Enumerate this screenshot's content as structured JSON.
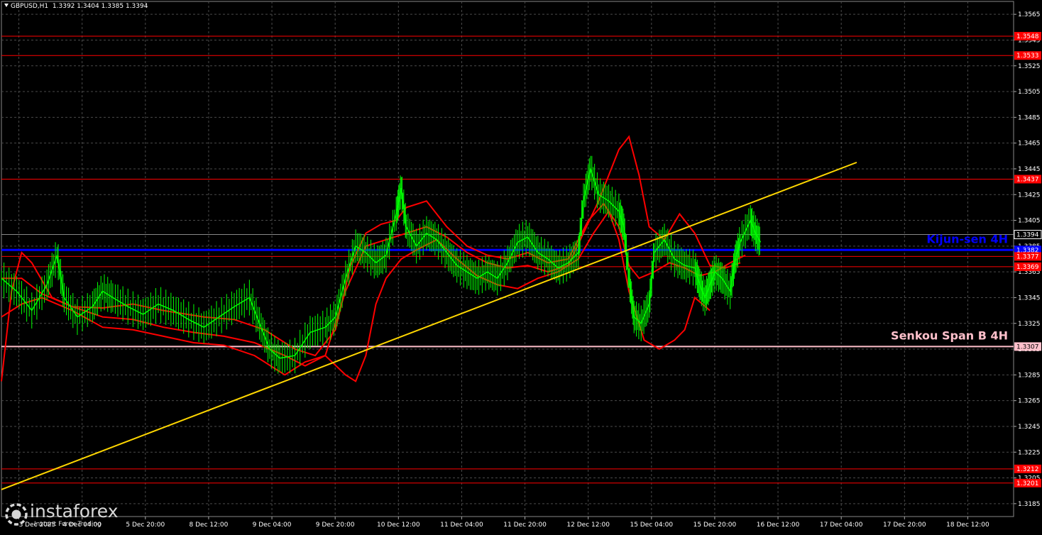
{
  "header": {
    "symbol": "GBPUSD,H1",
    "ohlc": "1.3392 1.3404 1.3385 1.3394"
  },
  "branding": {
    "name": "instaforex",
    "tagline": "Instant Forex Trading"
  },
  "colors": {
    "background": "#000000",
    "grid": "#4a4a4a",
    "candles": "#00ff00",
    "ichimoku_lines": "#ff0000",
    "level_lines": "#ff0000",
    "kijun_sen": "#0000ff",
    "senkou_span_b": "#ffc0cb",
    "trendline": "#ffd700",
    "axis_text": "#ffffff"
  },
  "chart_data": {
    "type": "line",
    "instrument": "GBPUSD",
    "timeframe": "H1",
    "ylim": [
      1.3175,
      1.3575
    ],
    "y_ticks": [
      "1.3565",
      "1.3545",
      "1.3525",
      "1.3505",
      "1.3485",
      "1.3465",
      "1.3445",
      "1.3425",
      "1.3405",
      "1.3385",
      "1.3365",
      "1.3345",
      "1.3325",
      "1.3305",
      "1.3285",
      "1.3265",
      "1.3245",
      "1.3225",
      "1.3205",
      "1.3185"
    ],
    "x_ticks": [
      "3 Dec 2025",
      "4 Dec 04:00",
      "5 Dec 20:00",
      "8 Dec 12:00",
      "9 Dec 04:00",
      "9 Dec 20:00",
      "10 Dec 12:00",
      "11 Dec 04:00",
      "11 Dec 20:00",
      "12 Dec 12:00",
      "15 Dec 04:00",
      "15 Dec 20:00",
      "16 Dec 12:00",
      "17 Dec 04:00",
      "17 Dec 20:00",
      "18 Dec 12:00"
    ],
    "current_price": "1.3394",
    "levels": [
      {
        "label": "1.3548",
        "value": 1.3548
      },
      {
        "label": "1.3533",
        "value": 1.3533
      },
      {
        "label": "1.3437",
        "value": 1.3437
      },
      {
        "label": "1.3382",
        "value": 1.3382,
        "kind": "kijun"
      },
      {
        "label": "1.3377",
        "value": 1.3377
      },
      {
        "label": "1.3369",
        "value": 1.3369
      },
      {
        "label": "1.3307",
        "value": 1.3307,
        "kind": "senkou"
      },
      {
        "label": "1.3212",
        "value": 1.3212
      },
      {
        "label": "1.3201",
        "value": 1.3201
      }
    ],
    "annotations": {
      "kijun": "Kijun-sen 4H",
      "senkou": "Senkou Span B 4H"
    },
    "trendline": {
      "from": [
        0.0,
        1.3196
      ],
      "to": [
        0.845,
        1.345
      ]
    },
    "price_path": [
      [
        0.0,
        1.336
      ],
      [
        0.015,
        1.335
      ],
      [
        0.03,
        1.3335
      ],
      [
        0.045,
        1.3355
      ],
      [
        0.055,
        1.3378
      ],
      [
        0.062,
        1.3345
      ],
      [
        0.075,
        1.333
      ],
      [
        0.09,
        1.3338
      ],
      [
        0.1,
        1.335
      ],
      [
        0.11,
        1.3345
      ],
      [
        0.125,
        1.3338
      ],
      [
        0.14,
        1.3332
      ],
      [
        0.155,
        1.334
      ],
      [
        0.17,
        1.3335
      ],
      [
        0.185,
        1.3328
      ],
      [
        0.2,
        1.3322
      ],
      [
        0.215,
        1.333
      ],
      [
        0.23,
        1.3338
      ],
      [
        0.245,
        1.3345
      ],
      [
        0.255,
        1.3325
      ],
      [
        0.265,
        1.3305
      ],
      [
        0.275,
        1.3298
      ],
      [
        0.29,
        1.33
      ],
      [
        0.305,
        1.3318
      ],
      [
        0.32,
        1.3322
      ],
      [
        0.33,
        1.333
      ],
      [
        0.34,
        1.336
      ],
      [
        0.35,
        1.3385
      ],
      [
        0.36,
        1.338
      ],
      [
        0.37,
        1.3372
      ],
      [
        0.38,
        1.3378
      ],
      [
        0.39,
        1.341
      ],
      [
        0.395,
        1.343
      ],
      [
        0.4,
        1.34
      ],
      [
        0.41,
        1.3385
      ],
      [
        0.42,
        1.3395
      ],
      [
        0.43,
        1.339
      ],
      [
        0.44,
        1.338
      ],
      [
        0.45,
        1.337
      ],
      [
        0.46,
        1.3365
      ],
      [
        0.47,
        1.336
      ],
      [
        0.48,
        1.3365
      ],
      [
        0.49,
        1.336
      ],
      [
        0.5,
        1.3372
      ],
      [
        0.51,
        1.3388
      ],
      [
        0.52,
        1.3392
      ],
      [
        0.53,
        1.338
      ],
      [
        0.54,
        1.3375
      ],
      [
        0.55,
        1.3368
      ],
      [
        0.56,
        1.3372
      ],
      [
        0.57,
        1.338
      ],
      [
        0.575,
        1.342
      ],
      [
        0.582,
        1.3445
      ],
      [
        0.59,
        1.3425
      ],
      [
        0.6,
        1.342
      ],
      [
        0.61,
        1.3412
      ],
      [
        0.615,
        1.34
      ],
      [
        0.62,
        1.336
      ],
      [
        0.625,
        1.333
      ],
      [
        0.632,
        1.3325
      ],
      [
        0.64,
        1.334
      ],
      [
        0.645,
        1.338
      ],
      [
        0.655,
        1.339
      ],
      [
        0.665,
        1.3375
      ],
      [
        0.675,
        1.337
      ],
      [
        0.685,
        1.3368
      ],
      [
        0.69,
        1.3355
      ],
      [
        0.695,
        1.3345
      ],
      [
        0.7,
        1.3355
      ],
      [
        0.705,
        1.3365
      ],
      [
        0.712,
        1.336
      ],
      [
        0.72,
        1.335
      ],
      [
        0.725,
        1.3375
      ],
      [
        0.73,
        1.3388
      ],
      [
        0.74,
        1.3405
      ],
      [
        0.745,
        1.3395
      ],
      [
        0.75,
        1.3388
      ]
    ],
    "ichimoku_lines": [
      [
        [
          0.0,
          1.328
        ],
        [
          0.01,
          1.335
        ],
        [
          0.02,
          1.338
        ],
        [
          0.03,
          1.3372
        ],
        [
          0.05,
          1.3345
        ],
        [
          0.07,
          1.3338
        ],
        [
          0.1,
          1.3337
        ],
        [
          0.13,
          1.334
        ],
        [
          0.16,
          1.3335
        ],
        [
          0.2,
          1.333
        ],
        [
          0.23,
          1.3328
        ],
        [
          0.26,
          1.332
        ],
        [
          0.29,
          1.3305
        ],
        [
          0.31,
          1.33
        ],
        [
          0.33,
          1.332
        ],
        [
          0.345,
          1.337
        ],
        [
          0.36,
          1.3395
        ],
        [
          0.375,
          1.3402
        ],
        [
          0.39,
          1.3405
        ],
        [
          0.4,
          1.3415
        ],
        [
          0.42,
          1.342
        ],
        [
          0.44,
          1.34
        ],
        [
          0.46,
          1.3385
        ],
        [
          0.48,
          1.3378
        ],
        [
          0.5,
          1.3375
        ],
        [
          0.52,
          1.338
        ],
        [
          0.54,
          1.3372
        ],
        [
          0.56,
          1.3375
        ],
        [
          0.58,
          1.3405
        ],
        [
          0.595,
          1.3418
        ],
        [
          0.61,
          1.34
        ],
        [
          0.62,
          1.337
        ],
        [
          0.63,
          1.336
        ],
        [
          0.645,
          1.3365
        ],
        [
          0.66,
          1.3372
        ],
        [
          0.675,
          1.3368
        ],
        [
          0.69,
          1.3362
        ],
        [
          0.705,
          1.3365
        ],
        [
          0.72,
          1.3372
        ],
        [
          0.735,
          1.3378
        ]
      ],
      [
        [
          0.0,
          1.333
        ],
        [
          0.02,
          1.334
        ],
        [
          0.04,
          1.3345
        ],
        [
          0.07,
          1.3335
        ],
        [
          0.1,
          1.3322
        ],
        [
          0.13,
          1.332
        ],
        [
          0.16,
          1.3315
        ],
        [
          0.19,
          1.331
        ],
        [
          0.22,
          1.3308
        ],
        [
          0.25,
          1.33
        ],
        [
          0.28,
          1.3285
        ],
        [
          0.3,
          1.3295
        ],
        [
          0.32,
          1.33
        ],
        [
          0.34,
          1.3285
        ],
        [
          0.35,
          1.328
        ],
        [
          0.36,
          1.33
        ],
        [
          0.37,
          1.334
        ],
        [
          0.38,
          1.336
        ],
        [
          0.395,
          1.3375
        ],
        [
          0.41,
          1.3382
        ],
        [
          0.43,
          1.339
        ],
        [
          0.45,
          1.3375
        ],
        [
          0.47,
          1.3362
        ],
        [
          0.49,
          1.3355
        ],
        [
          0.51,
          1.3352
        ],
        [
          0.53,
          1.336
        ],
        [
          0.55,
          1.3365
        ],
        [
          0.57,
          1.3375
        ],
        [
          0.585,
          1.3395
        ],
        [
          0.6,
          1.3412
        ],
        [
          0.61,
          1.339
        ],
        [
          0.62,
          1.335
        ],
        [
          0.635,
          1.3312
        ],
        [
          0.65,
          1.3305
        ],
        [
          0.665,
          1.3312
        ],
        [
          0.675,
          1.332
        ],
        [
          0.685,
          1.3345
        ],
        [
          0.7,
          1.3335
        ]
      ],
      [
        [
          0.0,
          1.336
        ],
        [
          0.02,
          1.336
        ],
        [
          0.04,
          1.3348
        ],
        [
          0.07,
          1.3338
        ],
        [
          0.1,
          1.333
        ],
        [
          0.13,
          1.3328
        ],
        [
          0.16,
          1.3322
        ],
        [
          0.19,
          1.3318
        ],
        [
          0.22,
          1.3315
        ],
        [
          0.25,
          1.331
        ],
        [
          0.28,
          1.33
        ],
        [
          0.3,
          1.3292
        ],
        [
          0.32,
          1.33
        ],
        [
          0.34,
          1.335
        ],
        [
          0.36,
          1.3385
        ],
        [
          0.38,
          1.339
        ],
        [
          0.4,
          1.3395
        ],
        [
          0.42,
          1.34
        ],
        [
          0.44,
          1.3392
        ],
        [
          0.46,
          1.338
        ],
        [
          0.48,
          1.3372
        ],
        [
          0.5,
          1.3368
        ],
        [
          0.52,
          1.337
        ],
        [
          0.54,
          1.3365
        ],
        [
          0.56,
          1.337
        ],
        [
          0.575,
          1.3395
        ],
        [
          0.59,
          1.342
        ],
        [
          0.6,
          1.344
        ],
        [
          0.61,
          1.346
        ],
        [
          0.62,
          1.347
        ],
        [
          0.63,
          1.344
        ],
        [
          0.64,
          1.34
        ],
        [
          0.655,
          1.339
        ],
        [
          0.67,
          1.341
        ],
        [
          0.685,
          1.3395
        ],
        [
          0.7,
          1.337
        ],
        [
          0.715,
          1.3368
        ],
        [
          0.73,
          1.3372
        ]
      ]
    ]
  }
}
